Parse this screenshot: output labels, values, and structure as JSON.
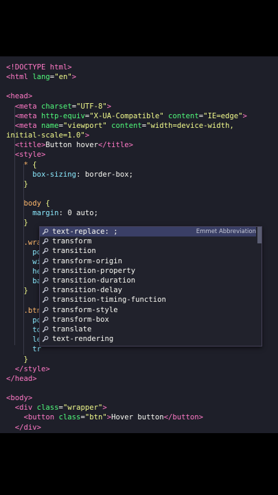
{
  "code_lines": [
    [
      [
        "tag",
        "<!DOCTYPE html>"
      ]
    ],
    [
      [
        "tag",
        "<html "
      ],
      [
        "attr",
        "lang"
      ],
      [
        "txt",
        "="
      ],
      [
        "str",
        "\"en\""
      ],
      [
        "tag",
        ">"
      ]
    ],
    [],
    [
      [
        "tag",
        "<head>"
      ]
    ],
    [
      [
        "txt",
        "  "
      ],
      [
        "tag",
        "<meta "
      ],
      [
        "attr",
        "charset"
      ],
      [
        "txt",
        "="
      ],
      [
        "str",
        "\"UTF-8\""
      ],
      [
        "tag",
        ">"
      ]
    ],
    [
      [
        "txt",
        "  "
      ],
      [
        "tag",
        "<meta "
      ],
      [
        "attr",
        "http-equiv"
      ],
      [
        "txt",
        "="
      ],
      [
        "str",
        "\"X-UA-Compatible\""
      ],
      [
        "txt",
        " "
      ],
      [
        "attr",
        "content"
      ],
      [
        "txt",
        "="
      ],
      [
        "str",
        "\"IE=edge\""
      ],
      [
        "tag",
        ">"
      ]
    ],
    [
      [
        "txt",
        "  "
      ],
      [
        "tag",
        "<meta "
      ],
      [
        "attr",
        "name"
      ],
      [
        "txt",
        "="
      ],
      [
        "str",
        "\"viewport\""
      ],
      [
        "txt",
        " "
      ],
      [
        "attr",
        "content"
      ],
      [
        "txt",
        "="
      ],
      [
        "str",
        "\"width=device-width,"
      ]
    ],
    [
      [
        "str",
        "initial-scale=1.0\""
      ],
      [
        "tag",
        ">"
      ]
    ],
    [
      [
        "txt",
        "  "
      ],
      [
        "tag",
        "<title>"
      ],
      [
        "txt",
        "Button hover"
      ],
      [
        "tag",
        "</title>"
      ]
    ],
    [
      [
        "txt",
        "  "
      ],
      [
        "tag",
        "<style>"
      ]
    ],
    [
      [
        "txt",
        "    "
      ],
      [
        "sel",
        "* "
      ],
      [
        "brace",
        "{"
      ]
    ],
    [
      [
        "txt",
        "      "
      ],
      [
        "prop",
        "box-sizing"
      ],
      [
        "txt",
        ": "
      ],
      [
        "val",
        "border-box"
      ],
      [
        "txt",
        ";"
      ]
    ],
    [
      [
        "txt",
        "    "
      ],
      [
        "brace",
        "}"
      ]
    ],
    [],
    [
      [
        "txt",
        "    "
      ],
      [
        "sel",
        "body "
      ],
      [
        "brace",
        "{"
      ]
    ],
    [
      [
        "txt",
        "      "
      ],
      [
        "prop",
        "margin"
      ],
      [
        "txt",
        ": "
      ],
      [
        "val",
        "0 auto"
      ],
      [
        "txt",
        ";"
      ]
    ],
    [
      [
        "txt",
        "    "
      ],
      [
        "brace",
        "}"
      ]
    ],
    [],
    [
      [
        "txt",
        "    "
      ],
      [
        "sel",
        ".wra"
      ]
    ],
    [
      [
        "txt",
        "      "
      ],
      [
        "prop",
        "po"
      ]
    ],
    [
      [
        "txt",
        "      "
      ],
      [
        "prop",
        "wi"
      ]
    ],
    [
      [
        "txt",
        "      "
      ],
      [
        "prop",
        "he"
      ]
    ],
    [
      [
        "txt",
        "      "
      ],
      [
        "prop",
        "ba"
      ]
    ],
    [
      [
        "txt",
        "    "
      ],
      [
        "brace",
        "}"
      ]
    ],
    [],
    [
      [
        "txt",
        "    "
      ],
      [
        "sel",
        ".btn"
      ]
    ],
    [
      [
        "txt",
        "      "
      ],
      [
        "prop",
        "po"
      ]
    ],
    [
      [
        "txt",
        "      "
      ],
      [
        "prop",
        "to"
      ]
    ],
    [
      [
        "txt",
        "      "
      ],
      [
        "prop",
        "le"
      ]
    ],
    [
      [
        "txt",
        "      "
      ],
      [
        "prop",
        "tr"
      ]
    ],
    [
      [
        "txt",
        "    "
      ],
      [
        "brace",
        "}"
      ]
    ],
    [
      [
        "txt",
        "  "
      ],
      [
        "tag",
        "</style>"
      ]
    ],
    [
      [
        "tag",
        "</head>"
      ]
    ],
    [],
    [
      [
        "tag",
        "<body>"
      ]
    ],
    [
      [
        "txt",
        "  "
      ],
      [
        "tag",
        "<div "
      ],
      [
        "attr",
        "class"
      ],
      [
        "txt",
        "="
      ],
      [
        "str",
        "\"wrapper\""
      ],
      [
        "tag",
        ">"
      ]
    ],
    [
      [
        "txt",
        "    "
      ],
      [
        "tag",
        "<button "
      ],
      [
        "attr",
        "class"
      ],
      [
        "txt",
        "="
      ],
      [
        "str",
        "\"btn\""
      ],
      [
        "tag",
        ">"
      ],
      [
        "txt",
        "Hover button"
      ],
      [
        "tag",
        "</button>"
      ]
    ],
    [
      [
        "txt",
        "  "
      ],
      [
        "tag",
        "</div>"
      ]
    ]
  ],
  "suggestions": {
    "items": [
      {
        "label": "text-replace: ;",
        "match": "tr",
        "detail": "Emmet Abbreviation",
        "icon": "wrench-icon"
      },
      {
        "label": "transform",
        "match": "tr",
        "icon": "wrench-icon"
      },
      {
        "label": "transition",
        "match": "tr",
        "icon": "wrench-icon"
      },
      {
        "label": "transform-origin",
        "match": "tr",
        "icon": "wrench-icon"
      },
      {
        "label": "transition-property",
        "match": "tr",
        "icon": "wrench-icon"
      },
      {
        "label": "transition-duration",
        "match": "tr",
        "icon": "wrench-icon"
      },
      {
        "label": "transition-delay",
        "match": "tr",
        "icon": "wrench-icon"
      },
      {
        "label": "transition-timing-function",
        "match": "tr",
        "icon": "wrench-icon"
      },
      {
        "label": "transform-style",
        "match": "tr",
        "icon": "wrench-icon"
      },
      {
        "label": "transform-box",
        "match": "tr",
        "icon": "wrench-icon"
      },
      {
        "label": "translate",
        "match": "tr",
        "icon": "wrench-icon"
      },
      {
        "label": "text-rendering",
        "match": "tr",
        "icon": "wrench-icon"
      }
    ],
    "active_index": 0
  },
  "colors": {
    "background": "#1e1f29",
    "tag": "#ff79c6",
    "attribute": "#50fa7b",
    "string": "#f1fa8c",
    "property": "#8be9fd",
    "selection": "#3a3f66"
  }
}
